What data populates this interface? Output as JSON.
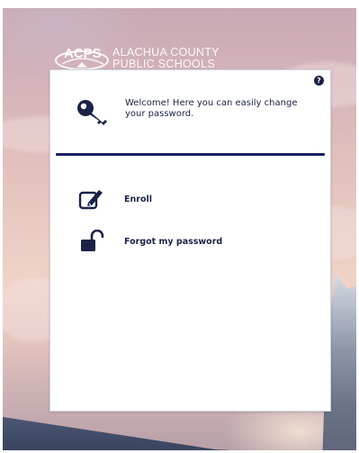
{
  "branding": {
    "logo_abbr": "ACPS",
    "logo_line1": "ALACHUA COUNTY",
    "logo_line2": "PUBLIC SCHOOLS"
  },
  "card": {
    "help_label": "?",
    "welcome_text": "Welcome! Here you can easily change your password.",
    "options": [
      {
        "label": "Enroll",
        "icon": "edit-icon"
      },
      {
        "label": "Forgot my password",
        "icon": "unlock-icon"
      }
    ]
  },
  "colors": {
    "navy": "#1a2247",
    "divider": "#1a2060",
    "card_bg": "#ffffff"
  }
}
